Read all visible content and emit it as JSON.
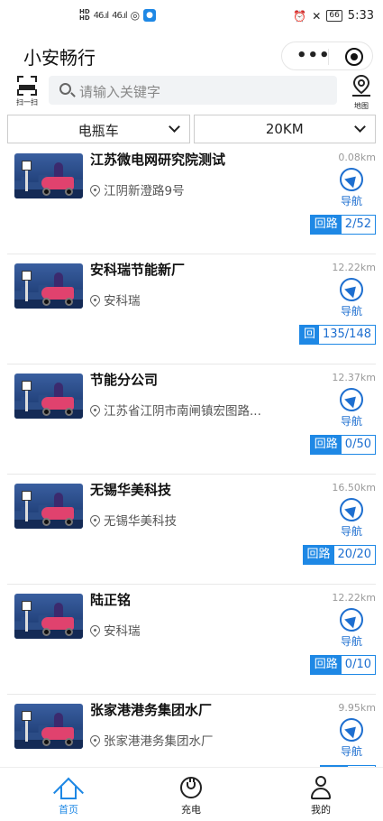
{
  "status_bar": {
    "time": "5:33",
    "battery": "66",
    "hd1": "HD",
    "hd2": "HD",
    "sig1": "46.ıl",
    "sig2": "46.ıl"
  },
  "header": {
    "title": "小安畅行",
    "more": "•••"
  },
  "search": {
    "scan_label": "扫一扫",
    "placeholder": "请输入关键字",
    "map_label": "地图"
  },
  "filters": {
    "vehicle": "电瓶车",
    "distance": "20KM"
  },
  "stations": [
    {
      "name": "江苏微电网研究院测试",
      "address": "江阴新澄路9号",
      "distance": "0.08km",
      "nav": "导航",
      "badge_key": "回路",
      "badge_value": "2/52"
    },
    {
      "name": "安科瑞节能新厂",
      "address": "安科瑞",
      "distance": "12.22km",
      "nav": "导航",
      "badge_key": "回",
      "badge_value": "135/148"
    },
    {
      "name": "节能分公司",
      "address": "江苏省江阴市南闸镇宏图路...",
      "distance": "12.37km",
      "nav": "导航",
      "badge_key": "回路",
      "badge_value": "0/50"
    },
    {
      "name": "无锡华美科技",
      "address": "无锡华美科技",
      "distance": "16.50km",
      "nav": "导航",
      "badge_key": "回路",
      "badge_value": "20/20"
    },
    {
      "name": "陆正铭",
      "address": "安科瑞",
      "distance": "12.22km",
      "nav": "导航",
      "badge_key": "回路",
      "badge_value": "0/10"
    },
    {
      "name": "张家港港务集团水厂",
      "address": "张家港港务集团水厂",
      "distance": "9.95km",
      "nav": "导航",
      "badge_key": "",
      "badge_value": ""
    }
  ],
  "tabs": {
    "home": "首页",
    "charge": "充电",
    "me": "我的"
  }
}
